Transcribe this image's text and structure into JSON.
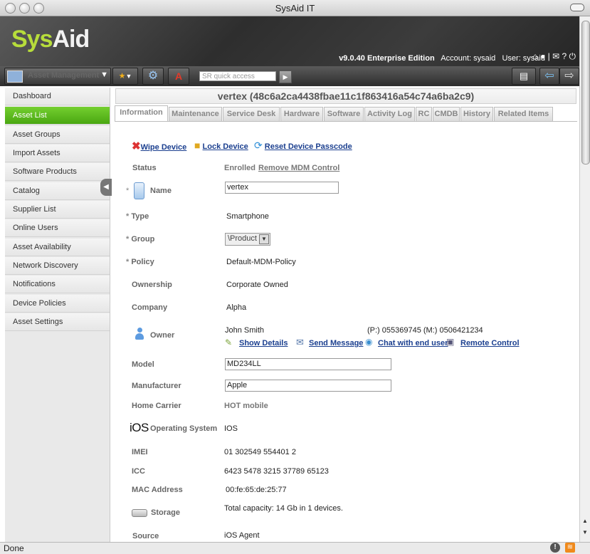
{
  "window": {
    "title": "SysAid IT"
  },
  "header": {
    "logo_part1": "Sys",
    "logo_part2": "Aid",
    "version": "v9.0.40 Enterprise Edition",
    "account": "Account: sysaid",
    "user": "User: sysaid"
  },
  "toolbar": {
    "module": "Asset Management",
    "search_placeholder": "SR quick access"
  },
  "sidebar": {
    "items": [
      {
        "label": "Dashboard"
      },
      {
        "label": "Asset List"
      },
      {
        "label": "Asset Groups"
      },
      {
        "label": "Import Assets"
      },
      {
        "label": "Software Products"
      },
      {
        "label": "Catalog"
      },
      {
        "label": "Supplier List"
      },
      {
        "label": "Online Users"
      },
      {
        "label": "Asset Availability"
      },
      {
        "label": "Network Discovery"
      },
      {
        "label": "Notifications"
      },
      {
        "label": "Device Policies"
      },
      {
        "label": "Asset Settings"
      }
    ]
  },
  "main": {
    "title": "vertex (48c6a2ca4438fbae11c1f863416a54c74a6ba2c9)",
    "tabs": [
      {
        "label": "Information"
      },
      {
        "label": "Maintenance"
      },
      {
        "label": "Service Desk"
      },
      {
        "label": "Hardware"
      },
      {
        "label": "Software"
      },
      {
        "label": "Activity Log"
      },
      {
        "label": "RC"
      },
      {
        "label": "CMDB"
      },
      {
        "label": "History"
      },
      {
        "label": "Related Items"
      }
    ],
    "actions": {
      "wipe": "Wipe Device",
      "lock": "Lock Device",
      "reset": "Reset Device Passcode"
    },
    "fields": {
      "status_label": "Status",
      "status_value": "Enrolled",
      "remove_mdm": "Remove MDM Control",
      "name_label": "Name",
      "name_value": "vertex",
      "type_label": "Type",
      "type_value": "Smartphone",
      "group_label": "Group",
      "group_value": "\\Product",
      "policy_label": "Policy",
      "policy_value": "Default-MDM-Policy",
      "ownership_label": "Ownership",
      "ownership_value": "Corporate Owned",
      "company_label": "Company",
      "company_value": "Alpha",
      "owner_label": "Owner",
      "owner_value": "John Smith",
      "owner_phones": "(P:) 055369745 (M:) 0506421234",
      "show_details": "Show Details",
      "send_message": "Send Message",
      "chat": "Chat with end user",
      "remote_control": "Remote Control",
      "model_label": "Model",
      "model_value": "MD234LL",
      "manufacturer_label": "Manufacturer",
      "manufacturer_value": "Apple",
      "carrier_label": "Home Carrier",
      "carrier_value": "HOT mobile",
      "os_logo": "iOS",
      "os_label": "Operating System",
      "os_value": "IOS",
      "imei_label": "IMEI",
      "imei_value": "01 302549 554401 2",
      "icc_label": "ICC",
      "icc_value": "6423 5478 3215 37789 65123",
      "mac_label": "MAC Address",
      "mac_value": "00:fe:65:de:25:77",
      "storage_label": "Storage",
      "storage_value": "Total capacity: 14 Gb in 1 devices.",
      "source_label": "Source",
      "source_value": "iOS Agent"
    }
  },
  "statusbar": {
    "text": "Done"
  }
}
